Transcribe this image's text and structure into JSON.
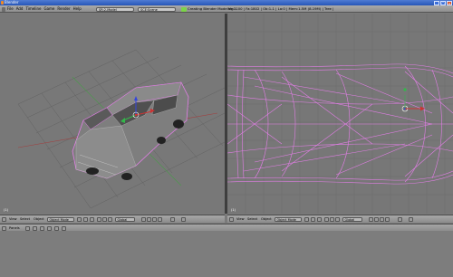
{
  "window": {
    "title": "Blender",
    "controls": [
      "_",
      "□",
      "x"
    ]
  },
  "info_header": {
    "menus": [
      "File",
      "Add",
      "Timeline",
      "Game",
      "Render",
      "Help"
    ],
    "screen_field": "SR:2-Model",
    "scene_field": "SCE:Scene",
    "status_message": "Creating Blender Modeling...",
    "stats": "Ve:3100 | Fa:1802 | Ob:1-1 | La:0 | Mem:1.5M (8.19M) | Tree |"
  },
  "viewport_left": {
    "label": "(1)"
  },
  "viewport_right": {
    "label": "(1)"
  },
  "header_left": {
    "view": "View",
    "select": "Select",
    "object": "Object",
    "mode": "Object Mode",
    "pivot": "Global"
  },
  "header_right": {
    "view": "View",
    "select": "Select",
    "object": "Object",
    "mode": "Object Mode",
    "pivot": "Global"
  },
  "buttons_header": {
    "panels": "Panels"
  },
  "colors": {
    "wire": "#e27ee6",
    "grid_line": "#5f5f5f",
    "axis_red": "#cc3333",
    "axis_green": "#33b84a",
    "axis_blue": "#3344dd"
  }
}
